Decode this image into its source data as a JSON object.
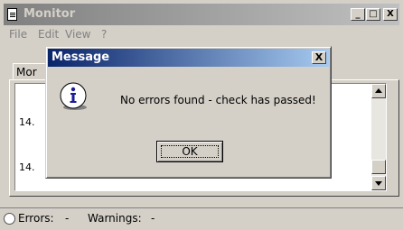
{
  "window": {
    "title": "Monitor"
  },
  "menu": [
    "File",
    "Edit",
    "View",
    "?"
  ],
  "tab": {
    "label": "Mor"
  },
  "list": {
    "rows": [
      "14.",
      "14."
    ]
  },
  "status": {
    "errors_label": "Errors:",
    "errors_value": "-",
    "warnings_label": "Warnings:",
    "warnings_value": "-"
  },
  "dialog": {
    "title": "Message",
    "message": "No errors found - check has passed!",
    "ok_label": "OK",
    "close_glyph": "X"
  },
  "titlebar_buttons": {
    "minimize": "_",
    "maximize": "□",
    "close": "X"
  }
}
